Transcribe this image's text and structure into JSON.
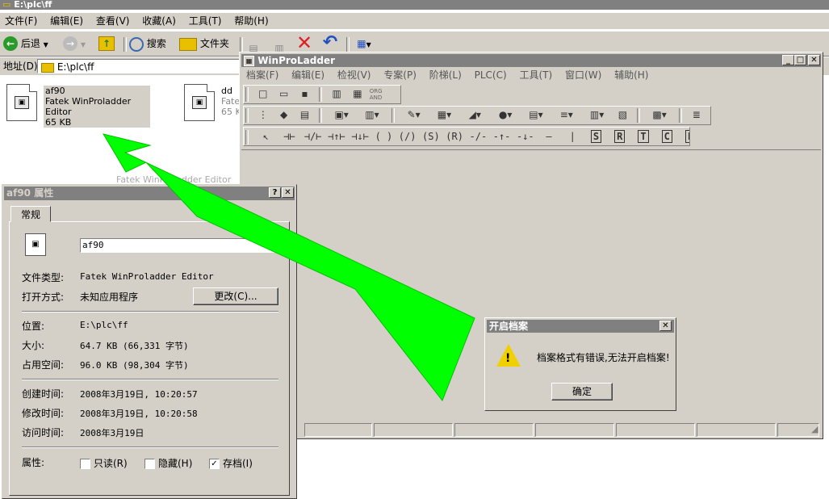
{
  "explorer": {
    "title": "E:\\plc\\ff",
    "menu": [
      "文件(F)",
      "编辑(E)",
      "查看(V)",
      "收藏(A)",
      "工具(T)",
      "帮助(H)"
    ],
    "toolbar": {
      "back": "后退",
      "search": "搜索",
      "folders": "文件夹"
    },
    "address_label": "地址(D)",
    "address_value": "E:\\plc\\ff",
    "files": [
      {
        "name": "af90",
        "type": "Fatek WinProladder Editor",
        "size": "65 KB"
      },
      {
        "name": "dd",
        "type": "Fate",
        "size": "65 K"
      }
    ],
    "behind_text": "Fatek WinProladder Editor"
  },
  "props": {
    "title": "af90 属性",
    "tab": "常规",
    "filename": "af90",
    "rows": [
      {
        "label": "文件类型:",
        "value": "Fatek WinProladder Editor"
      },
      {
        "label": "打开方式:",
        "value": "未知应用程序"
      },
      {
        "label": "位置:",
        "value": "E:\\plc\\ff"
      },
      {
        "label": "大小:",
        "value": "64.7 KB (66,331 字节)"
      },
      {
        "label": "占用空间:",
        "value": "96.0 KB (98,304 字节)"
      },
      {
        "label": "创建时间:",
        "value": "2008年3月19日, 10:20:57"
      },
      {
        "label": "修改时间:",
        "value": "2008年3月19日, 10:20:58"
      },
      {
        "label": "访问时间:",
        "value": "2008年3月19日"
      }
    ],
    "change_button": "更改(C)...",
    "attributes_label": "属性:",
    "attributes": [
      {
        "label": "只读(R)",
        "checked": false
      },
      {
        "label": "隐藏(H)",
        "checked": false
      },
      {
        "label": "存档(I)",
        "checked": true
      }
    ]
  },
  "winpro": {
    "title": "WinProLadder",
    "menu": [
      "档案(F)",
      "编辑(E)",
      "检视(V)",
      "专案(P)",
      "阶梯(L)",
      "PLC(C)",
      "工具(T)",
      "窗口(W)",
      "辅助(H)"
    ],
    "org_and": "ORG AND",
    "instr_letters": [
      "S",
      "R",
      "T",
      "C",
      "F"
    ]
  },
  "dialog": {
    "title": "开启档案",
    "message": "档案格式有错误,无法开启档案!",
    "ok": "确定"
  },
  "colors": {
    "face": "#d4d0c8",
    "inactive_title": "#808080",
    "arrow": "#00ff00",
    "close_x": "#e02020",
    "undo": "#2050c0"
  }
}
